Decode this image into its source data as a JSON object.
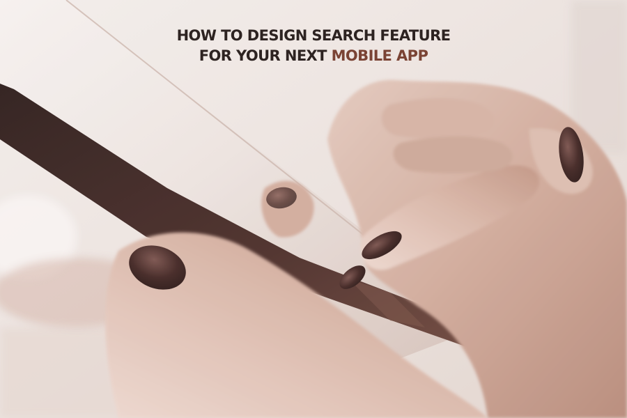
{
  "headline": {
    "line1": "HOW TO DESIGN SEARCH FEATURE",
    "line2_prefix": "FOR YOUR NEXT",
    "line2_accent": "MOBILE APP"
  },
  "colors": {
    "title": "#2d2321",
    "accent": "#7a4334",
    "background": "#f2efed",
    "skin": "#d6b5a6",
    "nail": "#4a2d2a",
    "phone_edge": "#3a2424"
  }
}
